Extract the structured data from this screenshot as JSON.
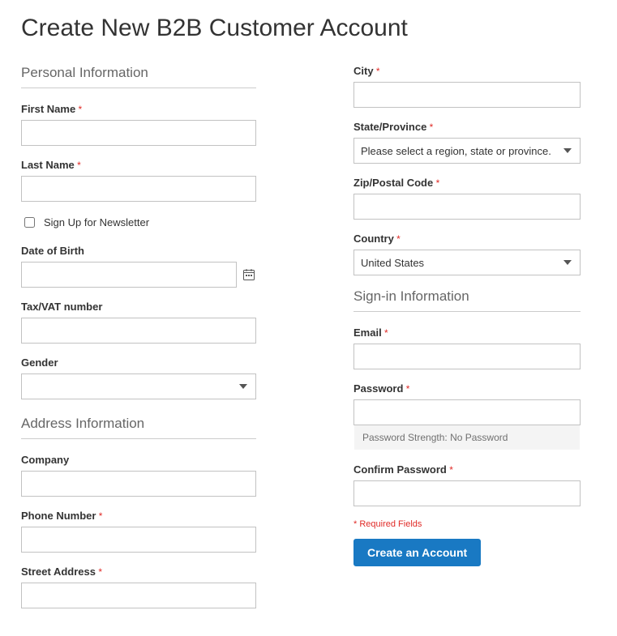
{
  "title": "Create New B2B Customer Account",
  "sections": {
    "personal": "Personal Information",
    "address": "Address Information",
    "signin": "Sign-in Information"
  },
  "labels": {
    "first_name": "First Name",
    "last_name": "Last Name",
    "newsletter": "Sign Up for Newsletter",
    "dob": "Date of Birth",
    "taxvat": "Tax/VAT number",
    "gender": "Gender",
    "company": "Company",
    "phone": "Phone Number",
    "street": "Street Address",
    "city": "City",
    "region": "State/Province",
    "zip": "Zip/Postal Code",
    "country": "Country",
    "email": "Email",
    "password": "Password",
    "confirm_password": "Confirm Password"
  },
  "placeholders": {
    "region": "Please select a region, state or province."
  },
  "values": {
    "country": "United States"
  },
  "password_meter": {
    "prefix": "Password Strength:",
    "value": "No Password"
  },
  "required_note": "* Required Fields",
  "submit": "Create an Account"
}
